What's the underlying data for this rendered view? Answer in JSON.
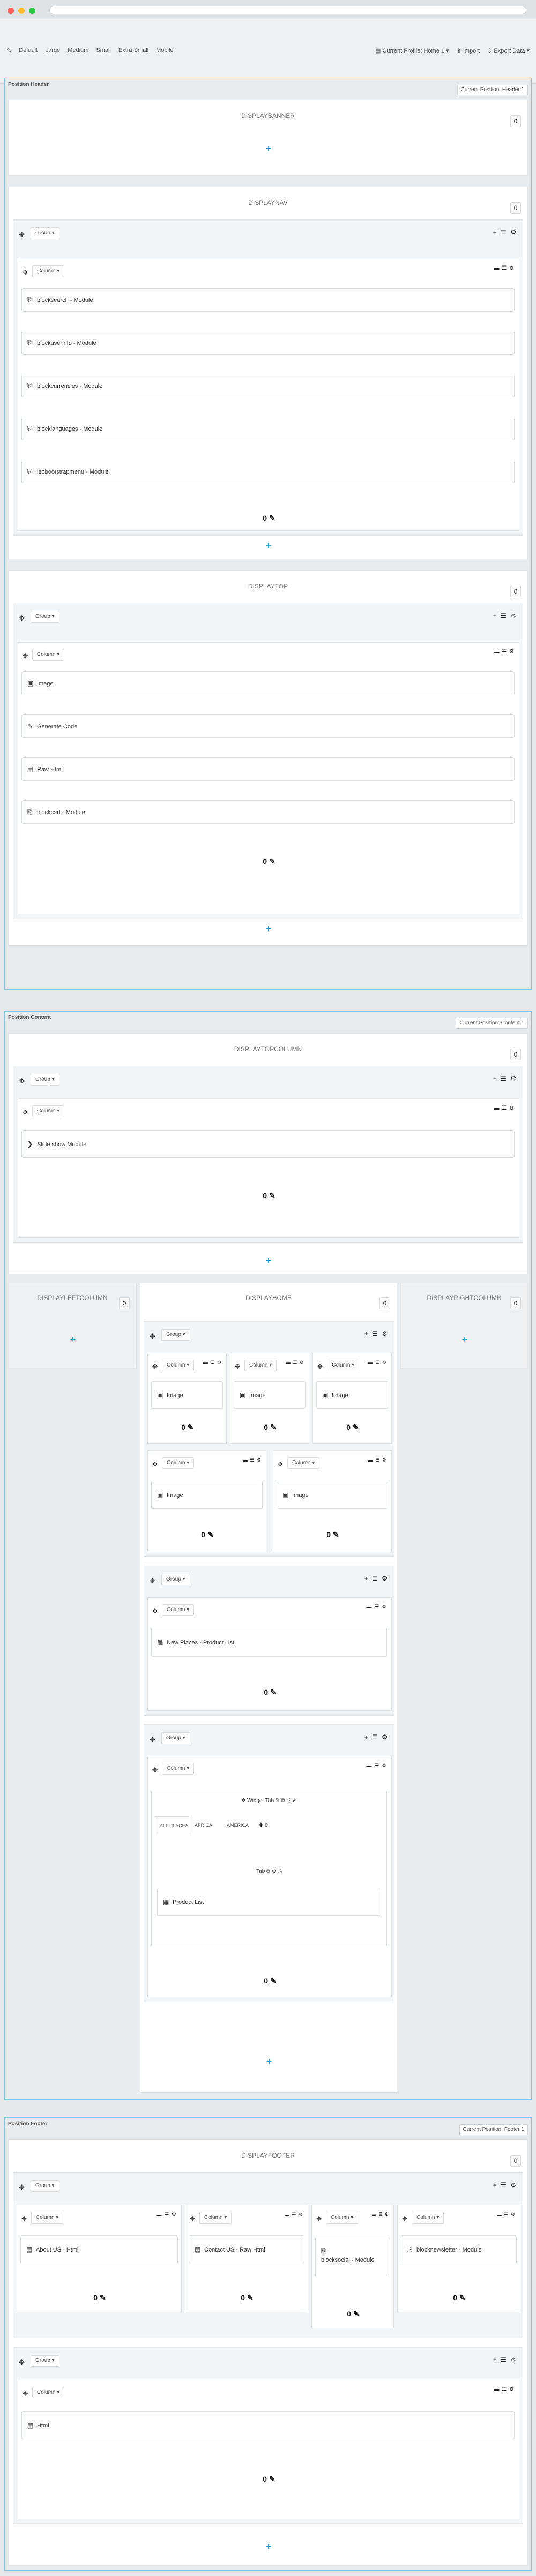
{
  "nav": {
    "left": [
      "Default",
      "Large",
      "Medium",
      "Small",
      "Extra Small",
      "Mobile"
    ],
    "right": [
      "Current Profile: Home 1",
      "Import",
      "Export Data"
    ]
  },
  "sections": {
    "header": {
      "title": "Position Header",
      "dropdown": "Current Position: Header 1"
    },
    "content": {
      "title": "Position Content",
      "dropdown": "Current Position: Content 1"
    },
    "footer": {
      "title": "Position Footer",
      "dropdown": "Current Position: Footer 1"
    }
  },
  "hooks": {
    "banner": "DISPLAYBANNER",
    "nav": "DISPLAYNAV",
    "top": "DISPLAYTOP",
    "topcolumn": "DISPLAYTOPCOLUMN",
    "leftcolumn": "DISPLAYLEFTCOLUMN",
    "home": "DISPLAYHOME",
    "rightcolumn": "DISPLAYRIGHTCOLUMN",
    "footer": "DISPLAYFOOTER"
  },
  "labels": {
    "group": "Group",
    "column": "Column",
    "badge": "0",
    "count": "0"
  },
  "modules": {
    "nav": [
      "blocksearch - Module",
      "blockuserinfo - Module",
      "blockcurrencies - Module",
      "blocklanguages - Module",
      "leobootstrapmenu - Module"
    ],
    "top": [
      "Image",
      "Generate Code",
      "Raw Html",
      "blockcart - Module"
    ],
    "topcolumn": [
      "Slide show Module"
    ],
    "home_images": [
      "Image",
      "Image",
      "Image",
      "Image",
      "Image"
    ],
    "product": "New Places - Product List",
    "product2": "Product List",
    "footer": [
      "About US - Html",
      "Contact US - Raw Html",
      "blocksocial - Module",
      "blocknewsletter - Module"
    ],
    "footer2": "Html"
  },
  "widget": {
    "title": "Widget Tab",
    "tabs": [
      "ALL PLACES",
      "AFRICA",
      "AMERICA"
    ],
    "sub": "Tab"
  }
}
